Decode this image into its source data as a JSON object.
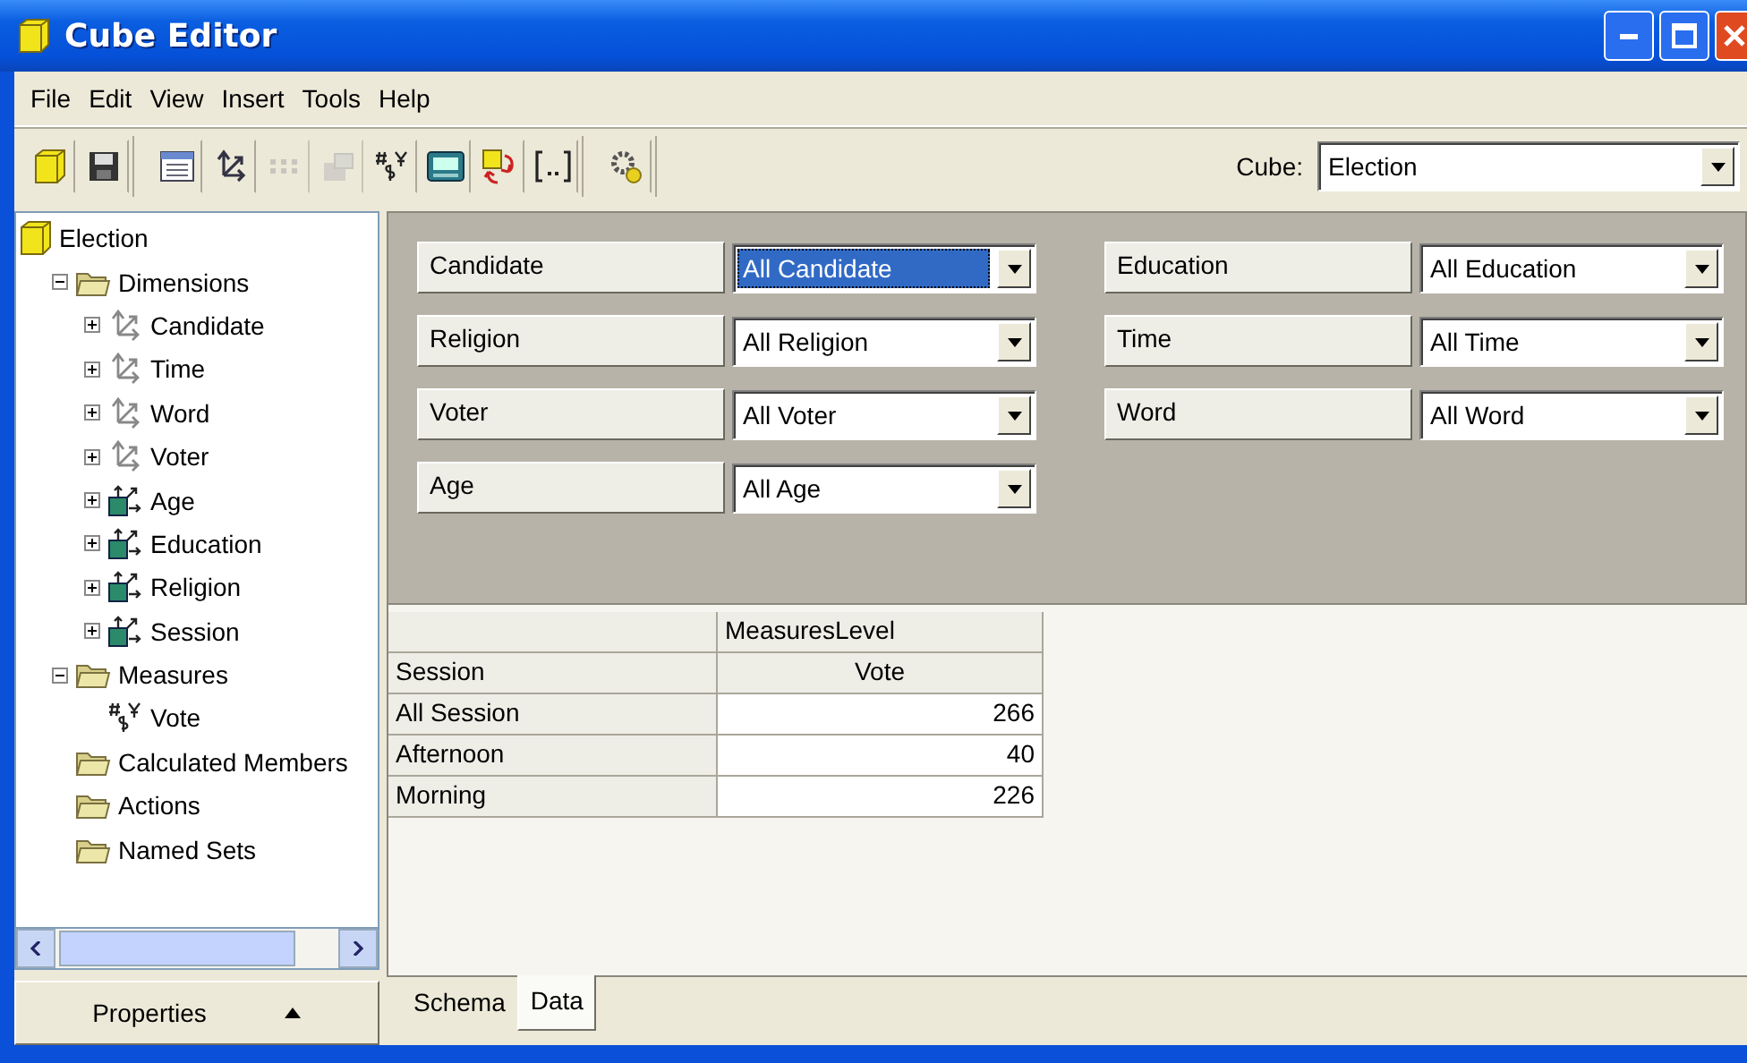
{
  "window": {
    "title": "Cube Editor"
  },
  "menu": [
    "File",
    "Edit",
    "View",
    "Insert",
    "Tools",
    "Help"
  ],
  "toolbar_groups": [
    {
      "buttons": [
        {
          "kind": "cube",
          "disabled": false
        },
        {
          "kind": "save",
          "disabled": false
        }
      ]
    },
    {
      "buttons": [
        {
          "kind": "table",
          "disabled": false
        },
        {
          "kind": "dimension",
          "disabled": false
        },
        {
          "kind": "dots",
          "disabled": true
        },
        {
          "kind": "level",
          "disabled": true
        },
        {
          "kind": "measure",
          "disabled": false
        },
        {
          "kind": "calculator",
          "disabled": false
        },
        {
          "kind": "refresh",
          "disabled": false
        },
        {
          "kind": "brackets",
          "disabled": false
        }
      ]
    },
    {
      "buttons": [
        {
          "kind": "gear",
          "disabled": false
        }
      ]
    }
  ],
  "cube_selector": {
    "label": "Cube:",
    "value": "Election"
  },
  "tree": [
    {
      "label": "Election",
      "kind": "cube",
      "children": [
        {
          "label": "Dimensions",
          "kind": "folder",
          "expanded": true,
          "children": [
            {
              "label": "Candidate",
              "kind": "shared-dimension",
              "expanded": false
            },
            {
              "label": "Time",
              "kind": "shared-dimension",
              "expanded": false
            },
            {
              "label": "Word",
              "kind": "shared-dimension",
              "expanded": false
            },
            {
              "label": "Voter",
              "kind": "shared-dimension",
              "expanded": false
            },
            {
              "label": "Age",
              "kind": "private-dimension",
              "expanded": false
            },
            {
              "label": "Education",
              "kind": "private-dimension",
              "expanded": false
            },
            {
              "label": "Religion",
              "kind": "private-dimension",
              "expanded": false
            },
            {
              "label": "Session",
              "kind": "private-dimension",
              "expanded": false
            }
          ]
        },
        {
          "label": "Measures",
          "kind": "folder",
          "expanded": true,
          "children": [
            {
              "label": "Vote",
              "kind": "measure"
            }
          ]
        },
        {
          "label": "Calculated Members",
          "kind": "folder"
        },
        {
          "label": "Actions",
          "kind": "folder"
        },
        {
          "label": "Named Sets",
          "kind": "folder"
        }
      ]
    }
  ],
  "properties_button": {
    "label": "Properties"
  },
  "filter_columns": [
    [
      {
        "label": "Candidate",
        "value": "All Candidate",
        "focused": true
      },
      {
        "label": "Religion",
        "value": "All Religion",
        "focused": false
      },
      {
        "label": "Voter",
        "value": "All Voter",
        "focused": false
      },
      {
        "label": "Age",
        "value": "All Age",
        "focused": false
      }
    ],
    [
      {
        "label": "Education",
        "value": "All Education",
        "focused": false
      },
      {
        "label": "Time",
        "value": "All Time",
        "focused": false
      },
      {
        "label": "Word",
        "value": "All Word",
        "focused": false
      }
    ]
  ],
  "grid": {
    "column_group": "MeasuresLevel",
    "row_header": "Session",
    "column_header": "Vote",
    "rows": [
      {
        "label": "All Session",
        "value": "266"
      },
      {
        "label": "Afternoon",
        "value": "40"
      },
      {
        "label": "Morning",
        "value": "226"
      }
    ]
  },
  "tabs": [
    {
      "label": "Schema",
      "selected": false
    },
    {
      "label": "Data",
      "selected": true
    }
  ]
}
